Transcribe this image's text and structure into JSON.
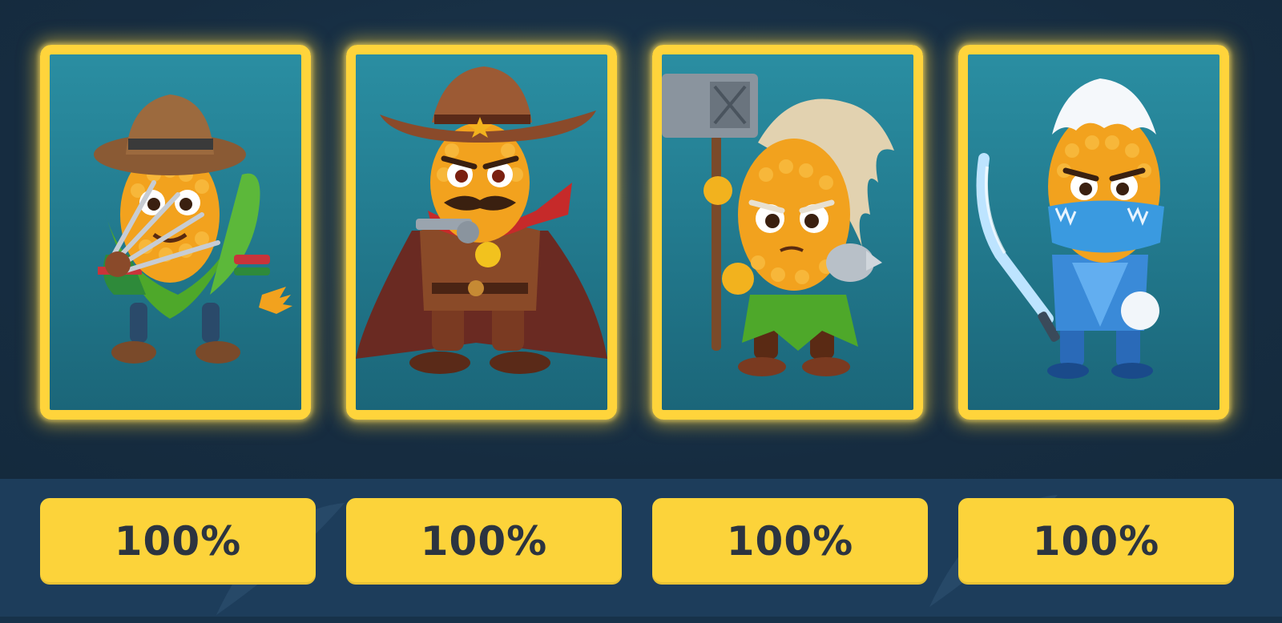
{
  "cards": [
    {
      "name": "claw-corn",
      "icon": "corn-claw-villain-icon",
      "percent": "100%"
    },
    {
      "name": "cowboy-corn",
      "icon": "corn-cowboy-icon",
      "percent": "100%"
    },
    {
      "name": "viking-corn",
      "icon": "corn-hammer-warrior-icon",
      "percent": "100%"
    },
    {
      "name": "ninja-corn",
      "icon": "corn-ice-ninja-icon",
      "percent": "100%"
    }
  ],
  "colors": {
    "card_border": "#ffd43b",
    "card_bg": "#237c90",
    "button_bg": "#fcd33a",
    "button_text": "#2c3440",
    "page_bg": "#17324a",
    "bottom_bg": "#1d3d5b"
  }
}
